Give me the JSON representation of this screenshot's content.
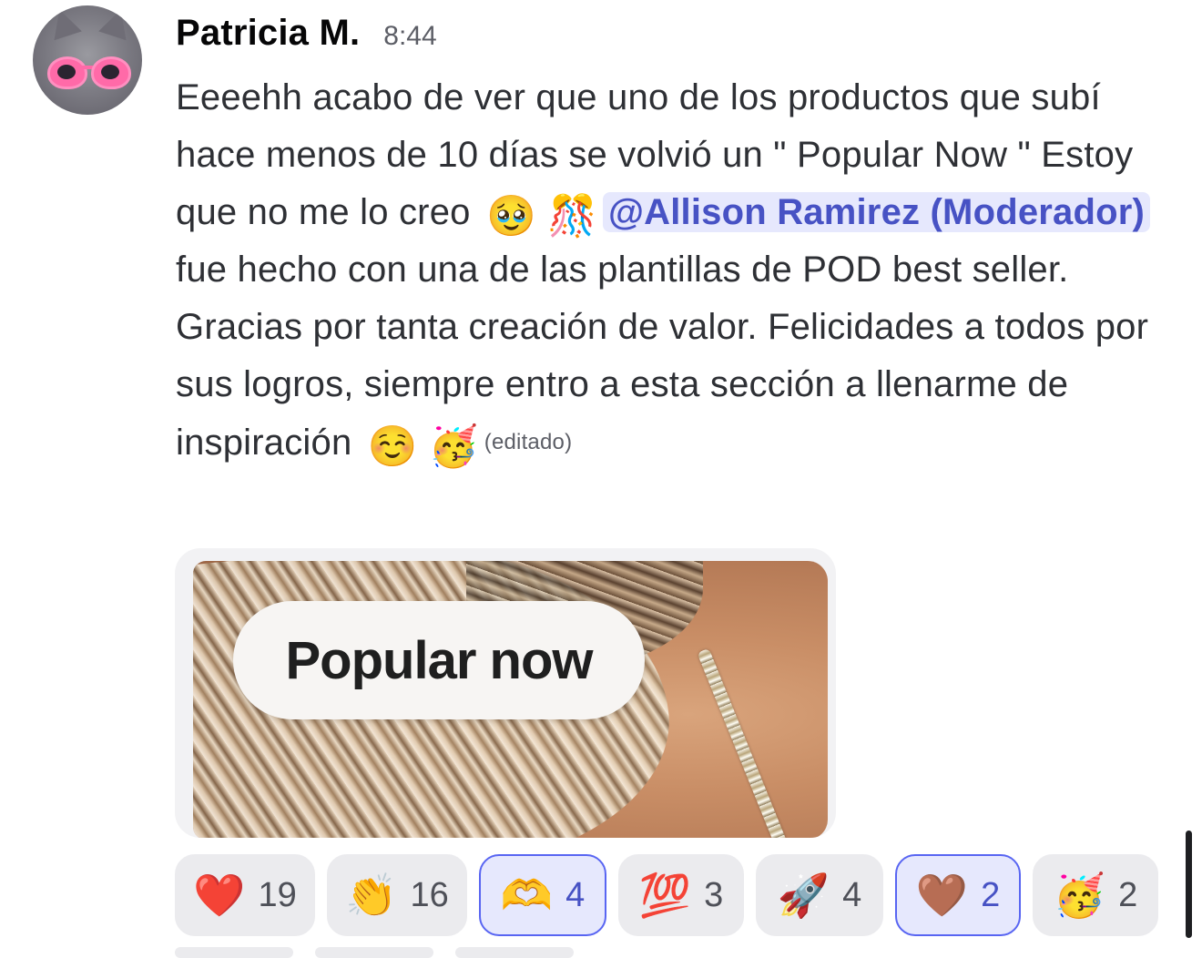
{
  "message": {
    "author": "Patricia M.",
    "timestamp": "8:44",
    "text_part1": "Eeeehh acabo de ver que uno de los productos que subí hace menos de 10 días se volvió un \" Popular Now \"  Estoy que no me lo creo",
    "emoji_1": "🥹",
    "emoji_2": "🎊",
    "mention": "@Allison Ramirez (Moderador)",
    "text_part2": " fue hecho con una de las plantillas de POD best seller. Gracias por tanta creación de valor. Felicidades a todos por sus logros, siempre entro a esta sección a llenarme de inspiración",
    "emoji_3": "☺️",
    "emoji_4": "🥳",
    "edited_label": "(editado)"
  },
  "attachment": {
    "badge_text": "Popular now"
  },
  "reactions": [
    {
      "emoji": "❤️",
      "icon": "red-heart-icon",
      "count": "19",
      "selected": false
    },
    {
      "emoji": "👏",
      "icon": "clapping-hands-icon",
      "count": "16",
      "selected": false
    },
    {
      "emoji": "🫶",
      "icon": "heart-hands-icon",
      "count": "4",
      "selected": true
    },
    {
      "emoji": "💯",
      "icon": "hundred-points-icon",
      "count": "3",
      "selected": false
    },
    {
      "emoji": "🚀",
      "icon": "rocket-icon",
      "count": "4",
      "selected": false
    },
    {
      "emoji": "🤎",
      "icon": "brown-heart-icon",
      "count": "2",
      "selected": true
    },
    {
      "emoji": "🥳",
      "icon": "partying-face-icon",
      "count": "2",
      "selected": false
    }
  ],
  "colors": {
    "mention_bg": "#e6e8fd",
    "mention_text": "#4752c4",
    "reaction_selected_border": "#5865f2",
    "reaction_bg": "#ebebee"
  }
}
